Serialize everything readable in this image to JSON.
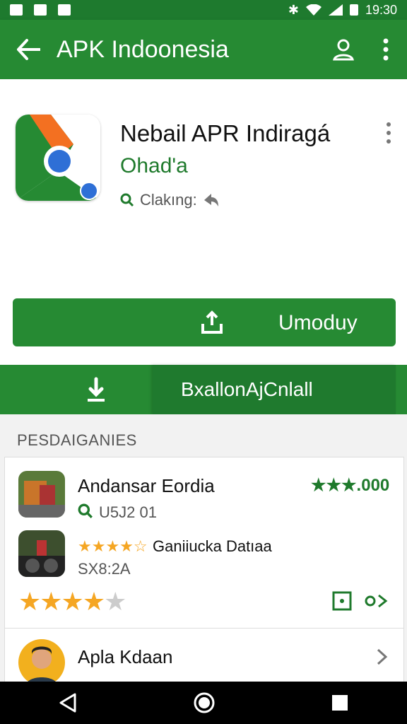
{
  "status_bar": {
    "time": "19:30"
  },
  "app_bar": {
    "title": "APK Indoonesia"
  },
  "app": {
    "name": "Nebail APR Indiragá",
    "developer": "Ohad'a",
    "meta": "Clakıng:"
  },
  "install_button": {
    "label": "Umoduy"
  },
  "secondary_bar": {
    "label": "BxallonAjCnlall"
  },
  "section": {
    "title": "PESDAIGANIES"
  },
  "list": [
    {
      "title": "Andansar Eordia",
      "sub": "U5J2 01",
      "rating": "★★★.000"
    },
    {
      "title": "Ganiiucka Datıaa",
      "sub": "SX8:2A",
      "stars": "★★★★☆"
    },
    {
      "title": "Apla Kdaan"
    }
  ],
  "colors": {
    "primary": "#268a33",
    "dark": "#1f7a2e",
    "star": "#f5a623"
  }
}
